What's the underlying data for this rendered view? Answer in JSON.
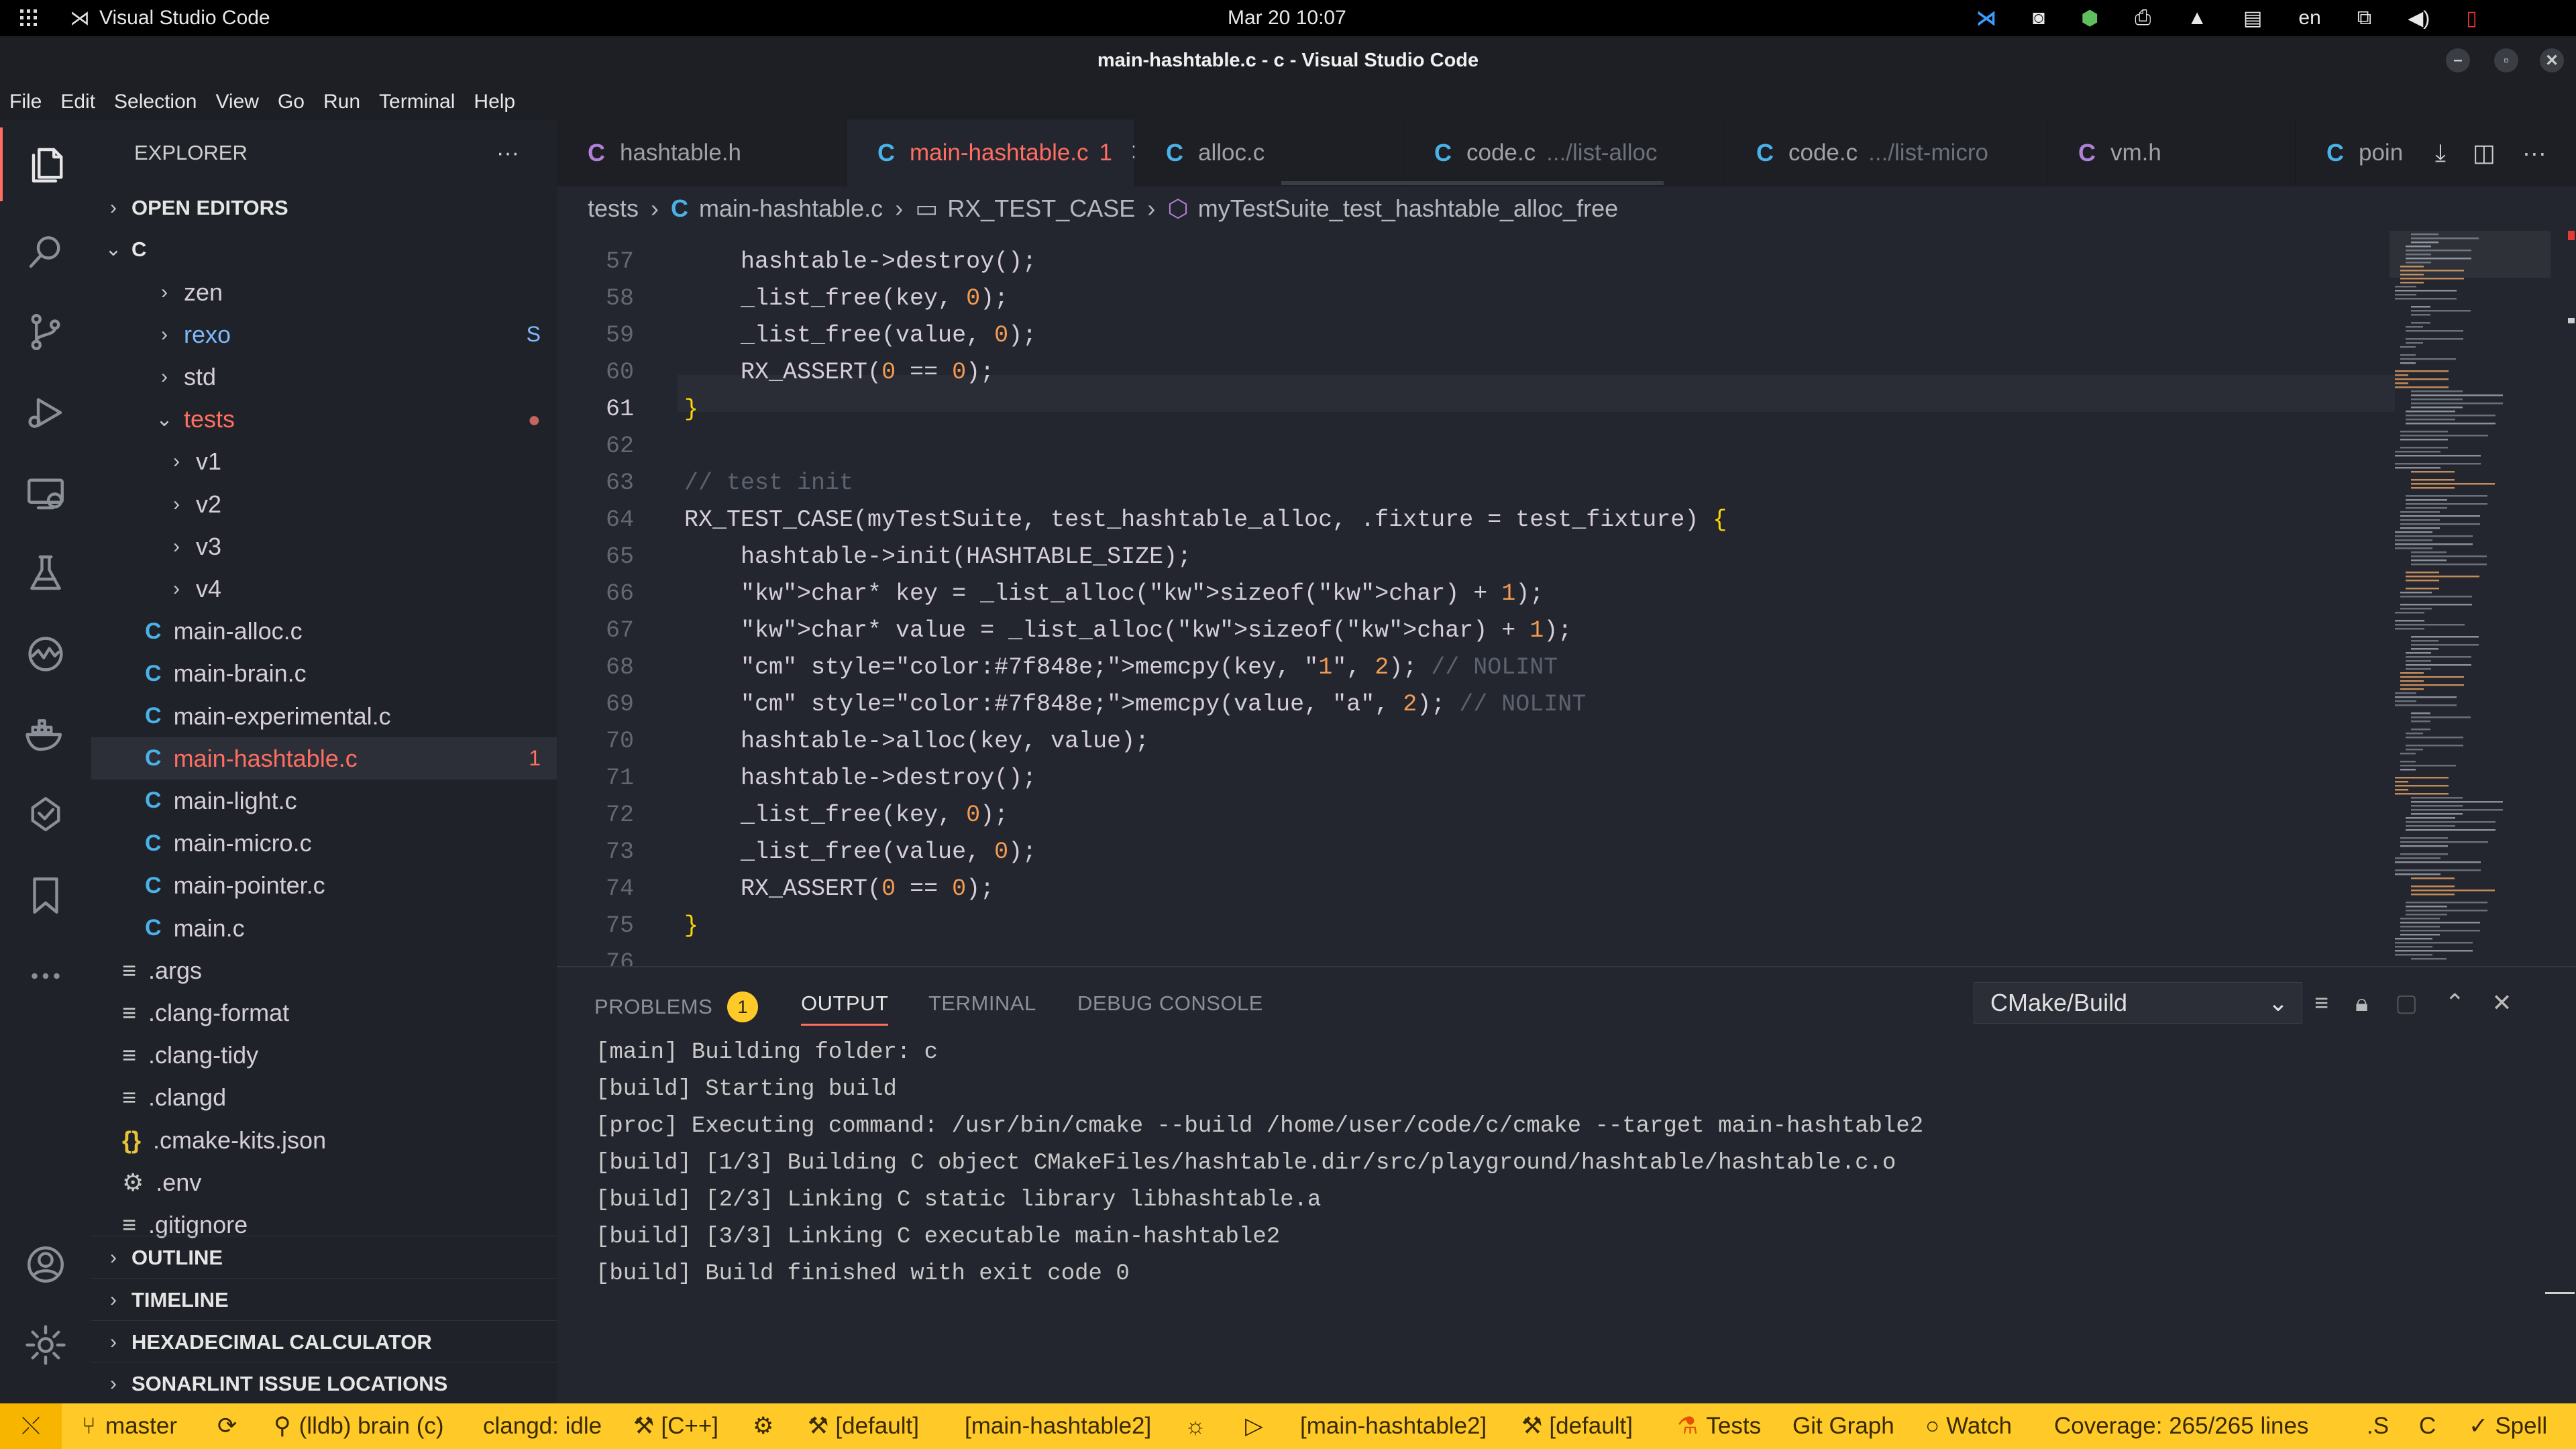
{
  "os": {
    "app_name": "Visual Studio Code",
    "clock": "Mar 20  10:07",
    "lang": "en"
  },
  "window": {
    "title": "main-hashtable.c - c - Visual Studio Code"
  },
  "menu": [
    "File",
    "Edit",
    "Selection",
    "View",
    "Go",
    "Run",
    "Terminal",
    "Help"
  ],
  "sidebar": {
    "title": "EXPLORER",
    "open_editors": "OPEN EDITORS",
    "root": "C",
    "items": [
      {
        "label": "zen",
        "kind": "folder",
        "badge": ""
      },
      {
        "label": "rexo",
        "kind": "folder",
        "badge": "S"
      },
      {
        "label": "std",
        "kind": "folder",
        "badge": ""
      },
      {
        "label": "tests",
        "kind": "folder-open",
        "badge": "●"
      },
      {
        "label": "v1",
        "kind": "folder",
        "badge": ""
      },
      {
        "label": "v2",
        "kind": "folder",
        "badge": ""
      },
      {
        "label": "v3",
        "kind": "folder",
        "badge": ""
      },
      {
        "label": "v4",
        "kind": "folder",
        "badge": ""
      },
      {
        "label": "main-alloc.c",
        "kind": "c",
        "badge": ""
      },
      {
        "label": "main-brain.c",
        "kind": "c",
        "badge": ""
      },
      {
        "label": "main-experimental.c",
        "kind": "c",
        "badge": ""
      },
      {
        "label": "main-hashtable.c",
        "kind": "c",
        "badge": "1"
      },
      {
        "label": "main-light.c",
        "kind": "c",
        "badge": ""
      },
      {
        "label": "main-micro.c",
        "kind": "c",
        "badge": ""
      },
      {
        "label": "main-pointer.c",
        "kind": "c",
        "badge": ""
      },
      {
        "label": "main.c",
        "kind": "c",
        "badge": ""
      },
      {
        "label": ".args",
        "kind": "lines",
        "badge": ""
      },
      {
        "label": ".clang-format",
        "kind": "lines",
        "badge": ""
      },
      {
        "label": ".clang-tidy",
        "kind": "lines",
        "badge": ""
      },
      {
        "label": ".clangd",
        "kind": "lines",
        "badge": ""
      },
      {
        "label": ".cmake-kits.json",
        "kind": "json",
        "badge": ""
      },
      {
        "label": ".env",
        "kind": "gear",
        "badge": ""
      },
      {
        "label": ".gitignore",
        "kind": "lines",
        "badge": ""
      }
    ],
    "sections": [
      "OUTLINE",
      "TIMELINE",
      "HEXADECIMAL CALCULATOR",
      "SONARLINT ISSUE LOCATIONS"
    ]
  },
  "tabs": [
    {
      "label": "hashtable.h",
      "hint": "",
      "icon_color": "#b180d7",
      "active": false
    },
    {
      "label": "main-hashtable.c",
      "hint": "1",
      "icon_color": "#49b2e8",
      "active": true
    },
    {
      "label": "alloc.c",
      "hint": "",
      "icon_color": "#49b2e8",
      "active": false
    },
    {
      "label": "code.c",
      "hint": ".../list-alloc",
      "icon_color": "#49b2e8",
      "active": false
    },
    {
      "label": "code.c",
      "hint": ".../list-micro",
      "icon_color": "#49b2e8",
      "active": false
    },
    {
      "label": "vm.h",
      "hint": "",
      "icon_color": "#b180d7",
      "active": false
    },
    {
      "label": "poin",
      "hint": "",
      "icon_color": "#49b2e8",
      "active": false
    }
  ],
  "breadcrumb": {
    "folder": "tests",
    "file": "main-hashtable.c",
    "symbol1": "RX_TEST_CASE",
    "symbol2": "myTestSuite_test_hashtable_alloc_free"
  },
  "editor": {
    "lines": [
      {
        "n": "57",
        "text": "    hashtable->destroy();"
      },
      {
        "n": "58",
        "text": "    _list_free(key, 0);"
      },
      {
        "n": "59",
        "text": "    _list_free(value, 0);"
      },
      {
        "n": "60",
        "text": "    RX_ASSERT(0 == 0);"
      },
      {
        "n": "61",
        "text": "}"
      },
      {
        "n": "62",
        "text": ""
      },
      {
        "n": "63",
        "text": "// test init"
      },
      {
        "n": "64",
        "text": "RX_TEST_CASE(myTestSuite, test_hashtable_alloc, .fixture = test_fixture) {"
      },
      {
        "n": "65",
        "text": "    hashtable->init(HASHTABLE_SIZE);"
      },
      {
        "n": "66",
        "text": "    char* key = _list_alloc(sizeof(char) + 1);"
      },
      {
        "n": "67",
        "text": "    char* value = _list_alloc(sizeof(char) + 1);"
      },
      {
        "n": "68",
        "text": "    memcpy(key, \"1\", 2); // NOLINT"
      },
      {
        "n": "69",
        "text": "    memcpy(value, \"a\", 2); // NOLINT"
      },
      {
        "n": "70",
        "text": "    hashtable->alloc(key, value);"
      },
      {
        "n": "71",
        "text": "    hashtable->destroy();"
      },
      {
        "n": "72",
        "text": "    _list_free(key, 0);"
      },
      {
        "n": "73",
        "text": "    _list_free(value, 0);"
      },
      {
        "n": "74",
        "text": "    RX_ASSERT(0 == 0);"
      },
      {
        "n": "75",
        "text": "}"
      },
      {
        "n": "76",
        "text": ""
      }
    ]
  },
  "panel": {
    "tabs": [
      "PROBLEMS",
      "OUTPUT",
      "TERMINAL",
      "DEBUG CONSOLE"
    ],
    "problems_count": "1",
    "channel": "CMake/Build",
    "output": [
      "[main] Building folder: c",
      "[build] Starting build",
      "[proc] Executing command: /usr/bin/cmake --build /home/user/code/c/cmake --target main-hashtable2",
      "[build] [1/3] Building C object CMakeFiles/hashtable.dir/src/playground/hashtable/hashtable.c.o",
      "[build] [2/3] Linking C static library libhashtable.a",
      "[build] [3/3] Linking C executable main-hashtable2",
      "[build] Build finished with exit code 0"
    ]
  },
  "status": {
    "branch": "master",
    "debug": "(lldb) brain (c)",
    "clangd": "clangd: idle",
    "lang_kit": "[C++]",
    "kit1": "[default]",
    "target1": "[main-hashtable2]",
    "target2": "[main-hashtable2]",
    "kit2": "[default]",
    "tests": "Tests",
    "gitgraph": "Git Graph",
    "watch": "Watch",
    "coverage": "Coverage: 265/265 lines",
    "s": ".S",
    "c": "C",
    "spell": "Spell"
  },
  "colors": {
    "accent": "#ff6e61",
    "status_bar": "#ffca28",
    "c_icon": "#49b2e8",
    "h_icon": "#b180d7"
  }
}
